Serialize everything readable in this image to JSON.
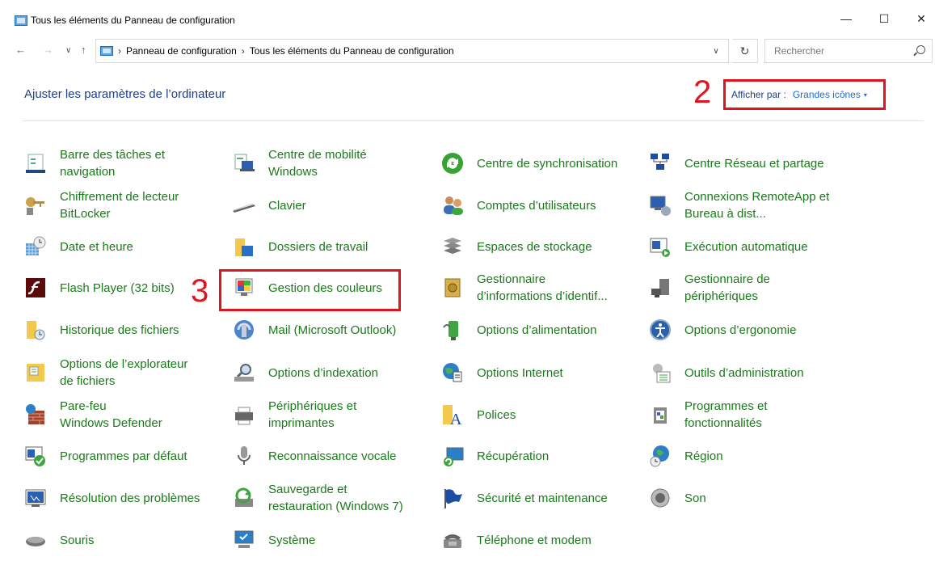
{
  "window": {
    "title": "Tous les éléments du Panneau de configuration",
    "minimize": "—",
    "maximize": "☐",
    "close": "✕"
  },
  "nav": {
    "back": "←",
    "forward": "→",
    "recent": "∨",
    "up": "↑",
    "breadcrumb": [
      "Panneau de configuration",
      "Tous les éléments du Panneau de configuration"
    ],
    "separator": "›",
    "dropdown": "∨",
    "refresh": "↻",
    "search_placeholder": "Rechercher"
  },
  "header": {
    "title": "Ajuster les paramètres de l’ordinateur",
    "view_by_label": "Afficher par :",
    "view_by_value": "Grandes icônes",
    "view_by_caret": "▾"
  },
  "annotations": {
    "two": "2",
    "three": "3"
  },
  "items": [
    {
      "label": "Barre des tâches et\nnavigation",
      "icon": "taskbar-icon"
    },
    {
      "label": "Centre de mobilité\nWindows",
      "icon": "mobility-icon"
    },
    {
      "label": "Centre de synchronisation",
      "icon": "sync-icon"
    },
    {
      "label": "Centre Réseau et partage",
      "icon": "network-icon"
    },
    {
      "label": "Chiffrement de lecteur\nBitLocker",
      "icon": "bitlocker-icon"
    },
    {
      "label": "Clavier",
      "icon": "keyboard-icon"
    },
    {
      "label": "Comptes d’utilisateurs",
      "icon": "users-icon"
    },
    {
      "label": "Connexions RemoteApp et\nBureau à dist...",
      "icon": "remoteapp-icon"
    },
    {
      "label": "Date et heure",
      "icon": "clock-icon"
    },
    {
      "label": "Dossiers de travail",
      "icon": "work-folders-icon"
    },
    {
      "label": "Espaces de stockage",
      "icon": "storage-icon"
    },
    {
      "label": "Exécution automatique",
      "icon": "autoplay-icon"
    },
    {
      "label": "Flash Player (32 bits)",
      "icon": "flash-icon"
    },
    {
      "label": "Gestion des couleurs",
      "icon": "color-management-icon"
    },
    {
      "label": "Gestionnaire\nd’informations d’identif...",
      "icon": "credential-icon"
    },
    {
      "label": "Gestionnaire de\npériphériques",
      "icon": "device-manager-icon"
    },
    {
      "label": "Historique des fichiers",
      "icon": "file-history-icon"
    },
    {
      "label": "Mail (Microsoft Outlook)",
      "icon": "mail-icon"
    },
    {
      "label": "Options d’alimentation",
      "icon": "power-icon"
    },
    {
      "label": "Options d’ergonomie",
      "icon": "ease-of-access-icon"
    },
    {
      "label": "Options de l’explorateur\nde fichiers",
      "icon": "explorer-options-icon"
    },
    {
      "label": "Options d’indexation",
      "icon": "indexing-icon"
    },
    {
      "label": "Options Internet",
      "icon": "internet-icon"
    },
    {
      "label": "Outils d’administration",
      "icon": "admin-tools-icon"
    },
    {
      "label": "Pare-feu\nWindows Defender",
      "icon": "firewall-icon"
    },
    {
      "label": "Périphériques et\nimprimantes",
      "icon": "printer-icon"
    },
    {
      "label": "Polices",
      "icon": "fonts-icon"
    },
    {
      "label": "Programmes et\nfonctionnalités",
      "icon": "programs-icon"
    },
    {
      "label": "Programmes par défaut",
      "icon": "default-programs-icon"
    },
    {
      "label": "Reconnaissance vocale",
      "icon": "microphone-icon"
    },
    {
      "label": "Récupération",
      "icon": "recovery-icon"
    },
    {
      "label": "Région",
      "icon": "region-icon"
    },
    {
      "label": "Résolution des problèmes",
      "icon": "troubleshoot-icon"
    },
    {
      "label": "Sauvegarde et\nrestauration (Windows 7)",
      "icon": "backup-icon"
    },
    {
      "label": "Sécurité et maintenance",
      "icon": "security-flag-icon"
    },
    {
      "label": "Son",
      "icon": "speaker-icon"
    },
    {
      "label": "Souris",
      "icon": "mouse-icon"
    },
    {
      "label": "Système",
      "icon": "system-icon"
    },
    {
      "label": "Téléphone et modem",
      "icon": "phone-icon"
    }
  ]
}
